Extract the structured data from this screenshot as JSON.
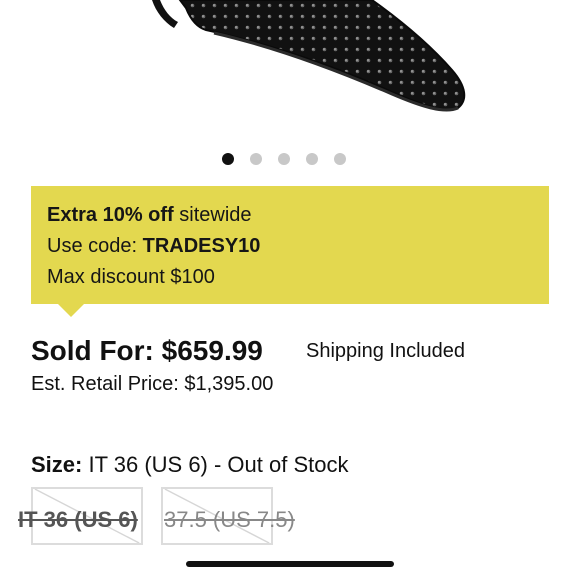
{
  "carousel": {
    "dot_count": 5,
    "active_index": 0
  },
  "promo": {
    "line1_bold": "Extra 10% off",
    "line1_rest": " sitewide",
    "line2_prefix": "Use code: ",
    "line2_code": "TRADESY10",
    "line3": "Max discount $100",
    "color": "#e3d84f"
  },
  "price": {
    "sold_for": "Sold For: $659.99",
    "shipping": "Shipping Included",
    "retail": "Est. Retail Price: $1,395.00"
  },
  "size": {
    "label": "Size:",
    "value": " IT 36 (US 6) - Out of Stock",
    "options": [
      {
        "label": "IT 36 (US 6)",
        "selected": true
      },
      {
        "label": "37.5 (US 7.5)",
        "selected": false
      }
    ]
  }
}
